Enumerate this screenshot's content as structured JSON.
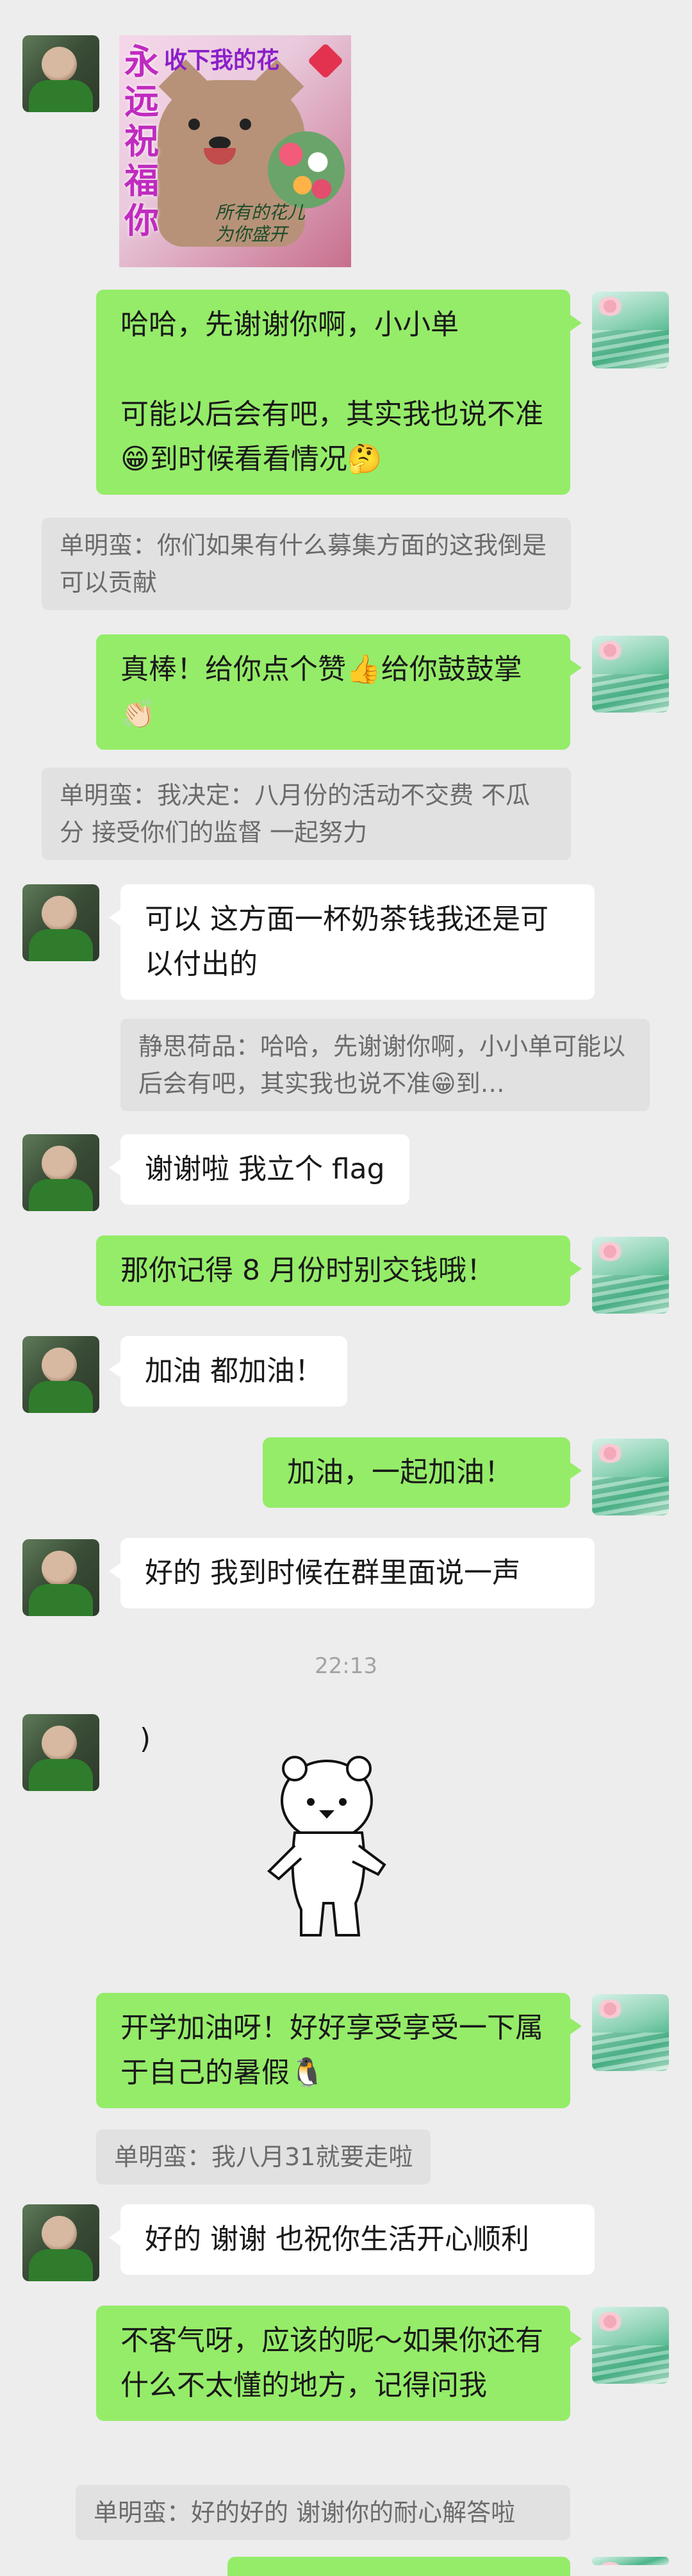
{
  "messages": [
    {
      "id": "m1",
      "text": "哈哈，先谢谢你啊，小小单\n\n可能以后会有吧，其实我也说不准😁到时候看看情况🤔"
    },
    {
      "id": "q1",
      "text": "单明蛮：你们如果有什么募集方面的这我倒是可以贡献"
    },
    {
      "id": "m2",
      "text": "真棒！给你点个赞👍给你鼓鼓掌👏🏻"
    },
    {
      "id": "q2",
      "text": "单明蛮：我决定：八月份的活动不交费 不瓜分 接受你们的监督 一起努力"
    },
    {
      "id": "m3",
      "text": "可以 这方面一杯奶茶钱我还是可以付出的"
    },
    {
      "id": "q3",
      "text": "静思荷品：哈哈，先谢谢你啊，小小单可能以后会有吧，其实我也说不准😁到…"
    },
    {
      "id": "m4",
      "text": "谢谢啦 我立个 flag"
    },
    {
      "id": "m5",
      "text": "那你记得 8 月份时别交钱哦！"
    },
    {
      "id": "m6",
      "text": "加油 都加油！"
    },
    {
      "id": "m7",
      "text": "加油，一起加油！"
    },
    {
      "id": "m8",
      "text": "好的 我到时候在群里面说一声"
    },
    {
      "id": "m9",
      "text": ")"
    },
    {
      "id": "m10",
      "text": "开学加油呀！好好享受享受一下属于自己的暑假🐧"
    },
    {
      "id": "q4",
      "text": "单明蛮：我八月31就要走啦"
    },
    {
      "id": "m11",
      "text": "好的 谢谢 也祝你生活开心顺利"
    },
    {
      "id": "m12",
      "text": "不客气呀，应该的呢～如果你还有什么不太懂的地方，记得问我"
    },
    {
      "id": "q5",
      "text": "单明蛮：好的好的 谢谢你的耐心解答啦"
    }
  ],
  "timestamp": "22:13",
  "sticker_card": {
    "vertical": "永远祝福你",
    "top": "收下我的花",
    "note": "所有的花儿\n为你盛开"
  },
  "icons": {
    "other_avatar": "avatar-photo-green",
    "me_avatar": "avatar-lotus-painting",
    "bear": "bear-sticker"
  },
  "colors": {
    "background": "#ededed",
    "my_bubble": "#95ec69",
    "other_bubble": "#ffffff",
    "quote_bg": "#e1e1e1"
  }
}
